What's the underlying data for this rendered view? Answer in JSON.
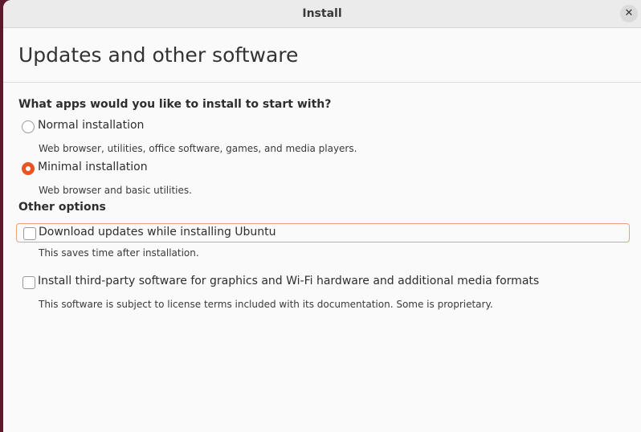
{
  "window": {
    "title": "Install",
    "close_icon": "✕"
  },
  "page": {
    "title": "Updates and other software"
  },
  "install_type": {
    "question": "What apps would you like to install to start with?",
    "options": [
      {
        "label": "Normal installation",
        "description": "Web browser, utilities, office software, games, and media players.",
        "selected": false
      },
      {
        "label": "Minimal installation",
        "description": "Web browser and basic utilities.",
        "selected": true
      }
    ]
  },
  "other_options": {
    "heading": "Other options",
    "items": [
      {
        "label": "Download updates while installing Ubuntu",
        "description": "This saves time after installation.",
        "checked": false
      },
      {
        "label": "Install third-party software for graphics and Wi-Fi hardware and additional media formats",
        "description": "This software is subject to license terms included with its documentation. Some is proprietary.",
        "checked": false
      }
    ]
  },
  "colors": {
    "accent": "#e95420",
    "focus_border": "#e9a07f"
  }
}
